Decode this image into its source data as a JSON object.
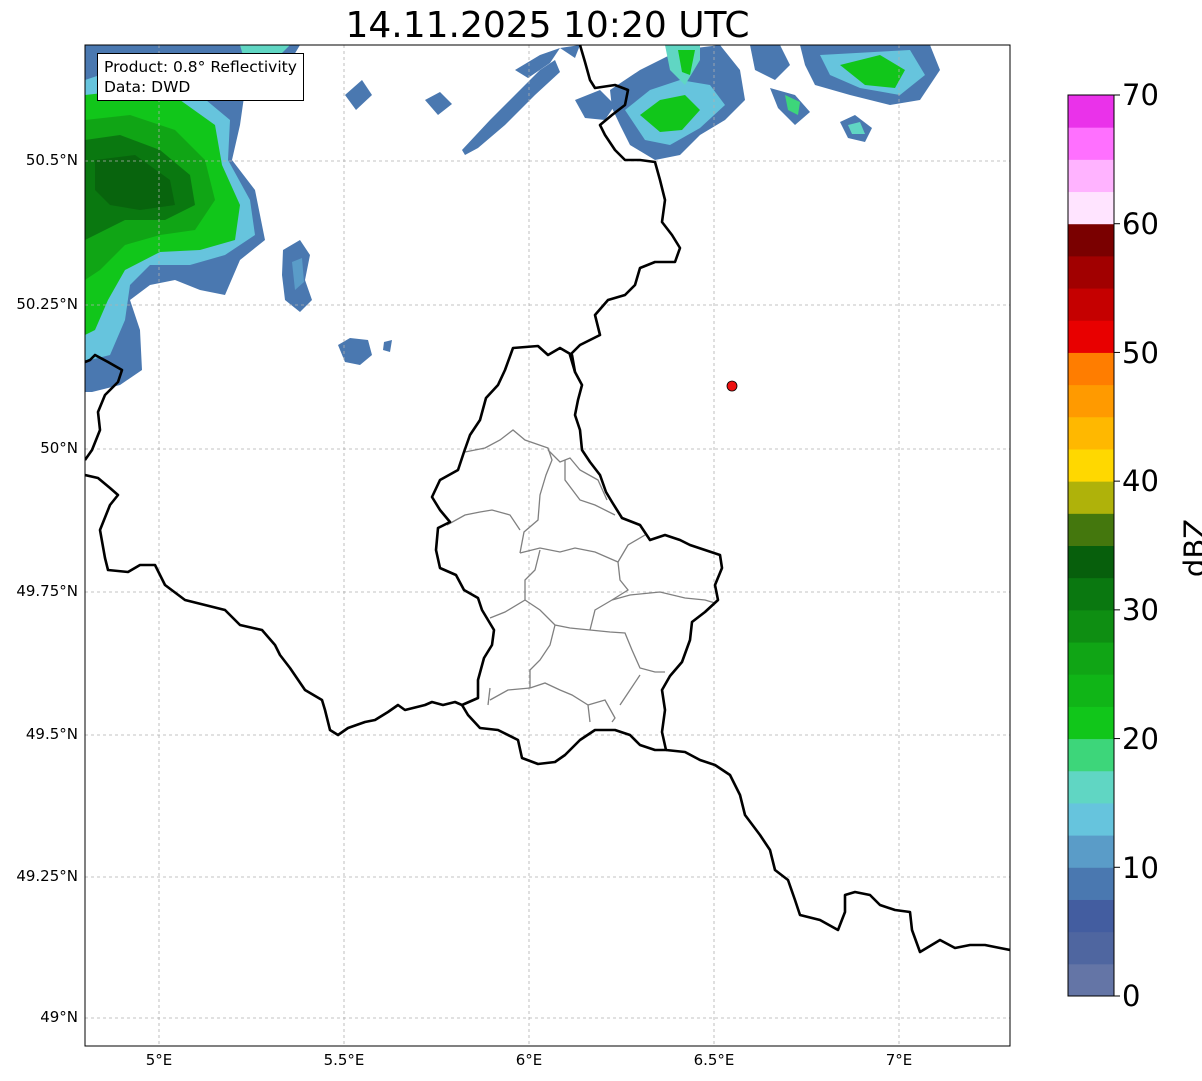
{
  "title": "14.11.2025 10:20 UTC",
  "info": {
    "product": "Product: 0.8° Reflectivity",
    "data": "Data: DWD"
  },
  "axes": {
    "y_ticks": [
      "50.5°N",
      "50.25°N",
      "50°N",
      "49.75°N",
      "49.5°N",
      "49.25°N",
      "49°N"
    ],
    "x_ticks": [
      "5°E",
      "5.5°E",
      "6°E",
      "6.5°E",
      "7°E"
    ],
    "lon_range": [
      4.8,
      7.3
    ],
    "lat_range": [
      48.95,
      50.7
    ],
    "grid": true
  },
  "marker": {
    "label": "",
    "lon": 6.55,
    "lat": 50.11,
    "color": "#ee1111"
  },
  "colorbar": {
    "label": "dBZ",
    "range": [
      0,
      70
    ],
    "ticks": [
      "0",
      "10",
      "20",
      "30",
      "40",
      "50",
      "60",
      "70"
    ],
    "colors": [
      "#6475a6",
      "#4f66a0",
      "#435da0",
      "#4a78b0",
      "#5a9cc8",
      "#66c4dd",
      "#60d6c3",
      "#3dd67a",
      "#11c61a",
      "#10b517",
      "#10a515",
      "#0e8e12",
      "#0a7810",
      "#075f0c",
      "#44770d",
      "#afb20a",
      "#ffd800",
      "#ffb800",
      "#ff9a00",
      "#ff7d00",
      "#e80000",
      "#c50000",
      "#a10000",
      "#7a0000",
      "#ffe4ff",
      "#ffb3ff",
      "#ff70ff",
      "#ea32ea"
    ]
  }
}
